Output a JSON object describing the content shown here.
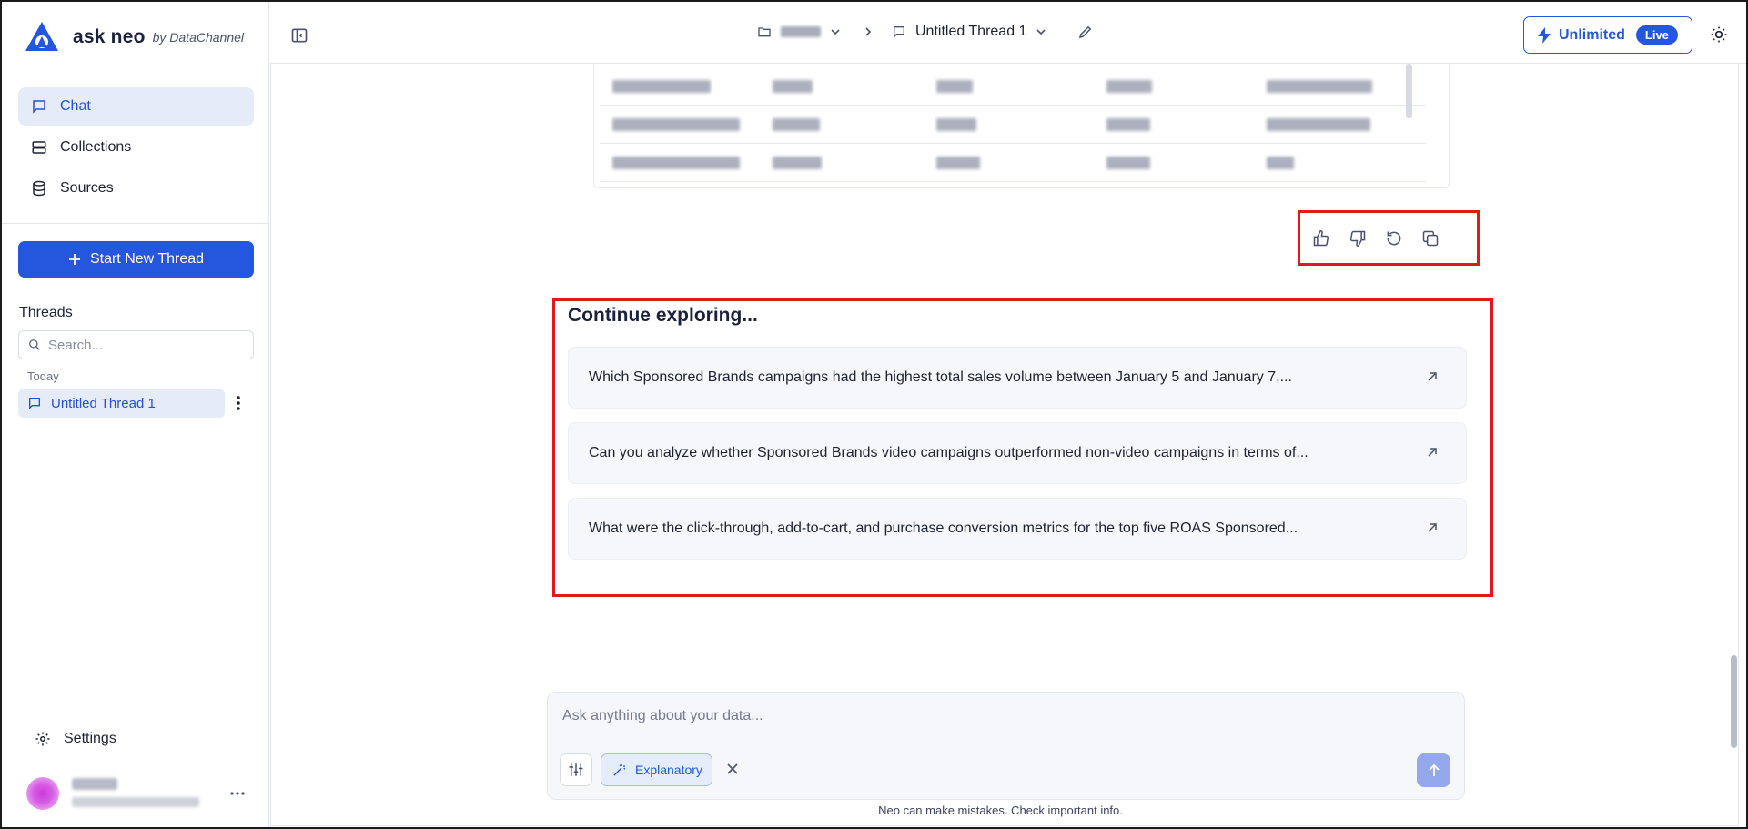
{
  "brand": {
    "name": "ask neo",
    "by": "by DataChannel"
  },
  "nav": [
    {
      "label": "Chat",
      "icon": "chat-icon",
      "active": true
    },
    {
      "label": "Collections",
      "icon": "collections-icon",
      "active": false
    },
    {
      "label": "Sources",
      "icon": "database-icon",
      "active": false
    }
  ],
  "new_thread_label": "Start New Thread",
  "threads": {
    "title": "Threads",
    "search_placeholder": "Search...",
    "group_label": "Today",
    "items": [
      {
        "label": "Untitled Thread 1"
      }
    ]
  },
  "settings_label": "Settings",
  "topbar": {
    "thread_title": "Untitled Thread 1",
    "plan_label": "Unlimited",
    "plan_badge": "Live"
  },
  "explore": {
    "title": "Continue exploring...",
    "suggestions": [
      "Which Sponsored Brands campaigns had the highest total sales volume between January 5 and January 7,...",
      "Can you analyze whether Sponsored Brands video campaigns outperformed non-video campaigns in terms of...",
      "What were the click-through, add-to-cart, and purchase conversion metrics for the top five ROAS Sponsored..."
    ]
  },
  "composer": {
    "placeholder": "Ask anything about your data...",
    "mode_label": "Explanatory"
  },
  "disclaimer": "Neo can make mistakes. Check important info.",
  "colors": {
    "accent": "#2457dd",
    "highlight": "#e01919"
  }
}
